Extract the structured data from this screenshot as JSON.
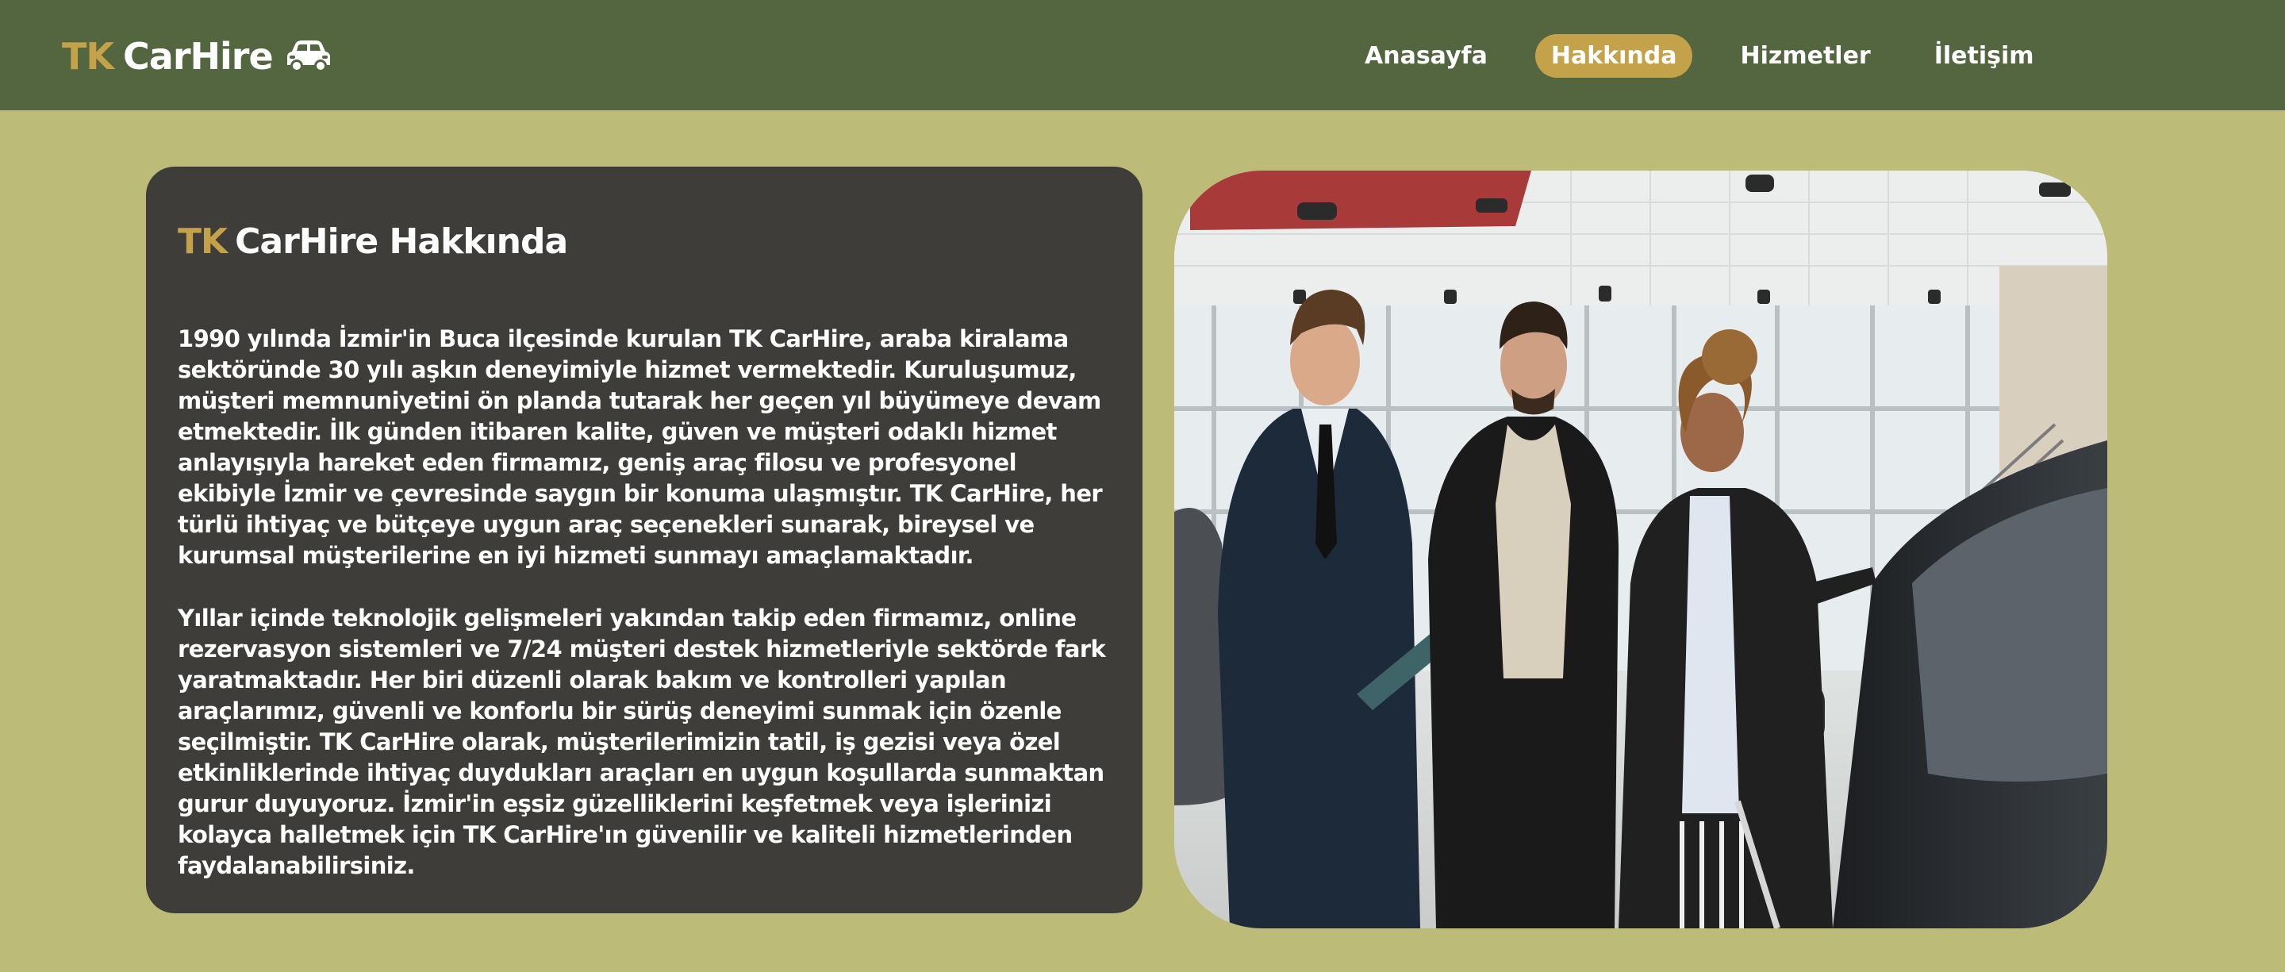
{
  "header": {
    "brand_tk": "TK",
    "brand_name": "CarHire",
    "brand_icon": "car-icon",
    "nav": [
      {
        "label": "Anasayfa",
        "active": false
      },
      {
        "label": "Hakkında",
        "active": true
      },
      {
        "label": "Hizmetler",
        "active": false
      },
      {
        "label": "İletişim",
        "active": false
      }
    ]
  },
  "about": {
    "title_tk": "TK",
    "title_rest": "CarHire Hakkında",
    "paragraph1": "1990 yılında İzmir'in Buca ilçesinde kurulan TK CarHire, araba kiralama sektöründe 30 yılı aşkın deneyimiyle hizmet vermektedir. Kuruluşumuz, müşteri memnuniyetini ön planda tutarak her geçen yıl büyümeye devam etmektedir. İlk günden itibaren kalite, güven ve müşteri odaklı hizmet anlayışıyla hareket eden firmamız, geniş araç filosu ve profesyonel ekibiyle İzmir ve çevresinde saygın bir konuma ulaşmıştır. TK CarHire, her türlü ihtiyaç ve bütçeye uygun araç seçenekleri sunarak, bireysel ve kurumsal müşterilerine en iyi hizmeti sunmayı amaçlamaktadır.",
    "paragraph2": "Yıllar içinde teknolojik gelişmeleri yakından takip eden firmamız, online rezervasyon sistemleri ve 7/24 müşteri destek hizmetleriyle sektörde fark yaratmaktadır. Her biri düzenli olarak bakım ve kontrolleri yapılan araçlarımız, güvenli ve konforlu bir sürüş deneyimi sunmak için özenle seçilmiştir. TK CarHire olarak, müşterilerimizin tatil, iş gezisi veya özel etkinliklerinde ihtiyaç duydukları araçları en uygun koşullarda sunmaktan gurur duyuyoruz. İzmir'in eşsiz güzelliklerini keşfetmek veya işlerinizi kolayca halletmek için TK CarHire'ın güvenilir ve kaliteli hizmetlerinden faydalanabilirsiniz."
  },
  "colors": {
    "header_bg": "#536640",
    "page_bg": "#bdbb78",
    "accent": "#c4a24a",
    "panel_bg": "#3e3d39",
    "text": "#ffffff"
  }
}
